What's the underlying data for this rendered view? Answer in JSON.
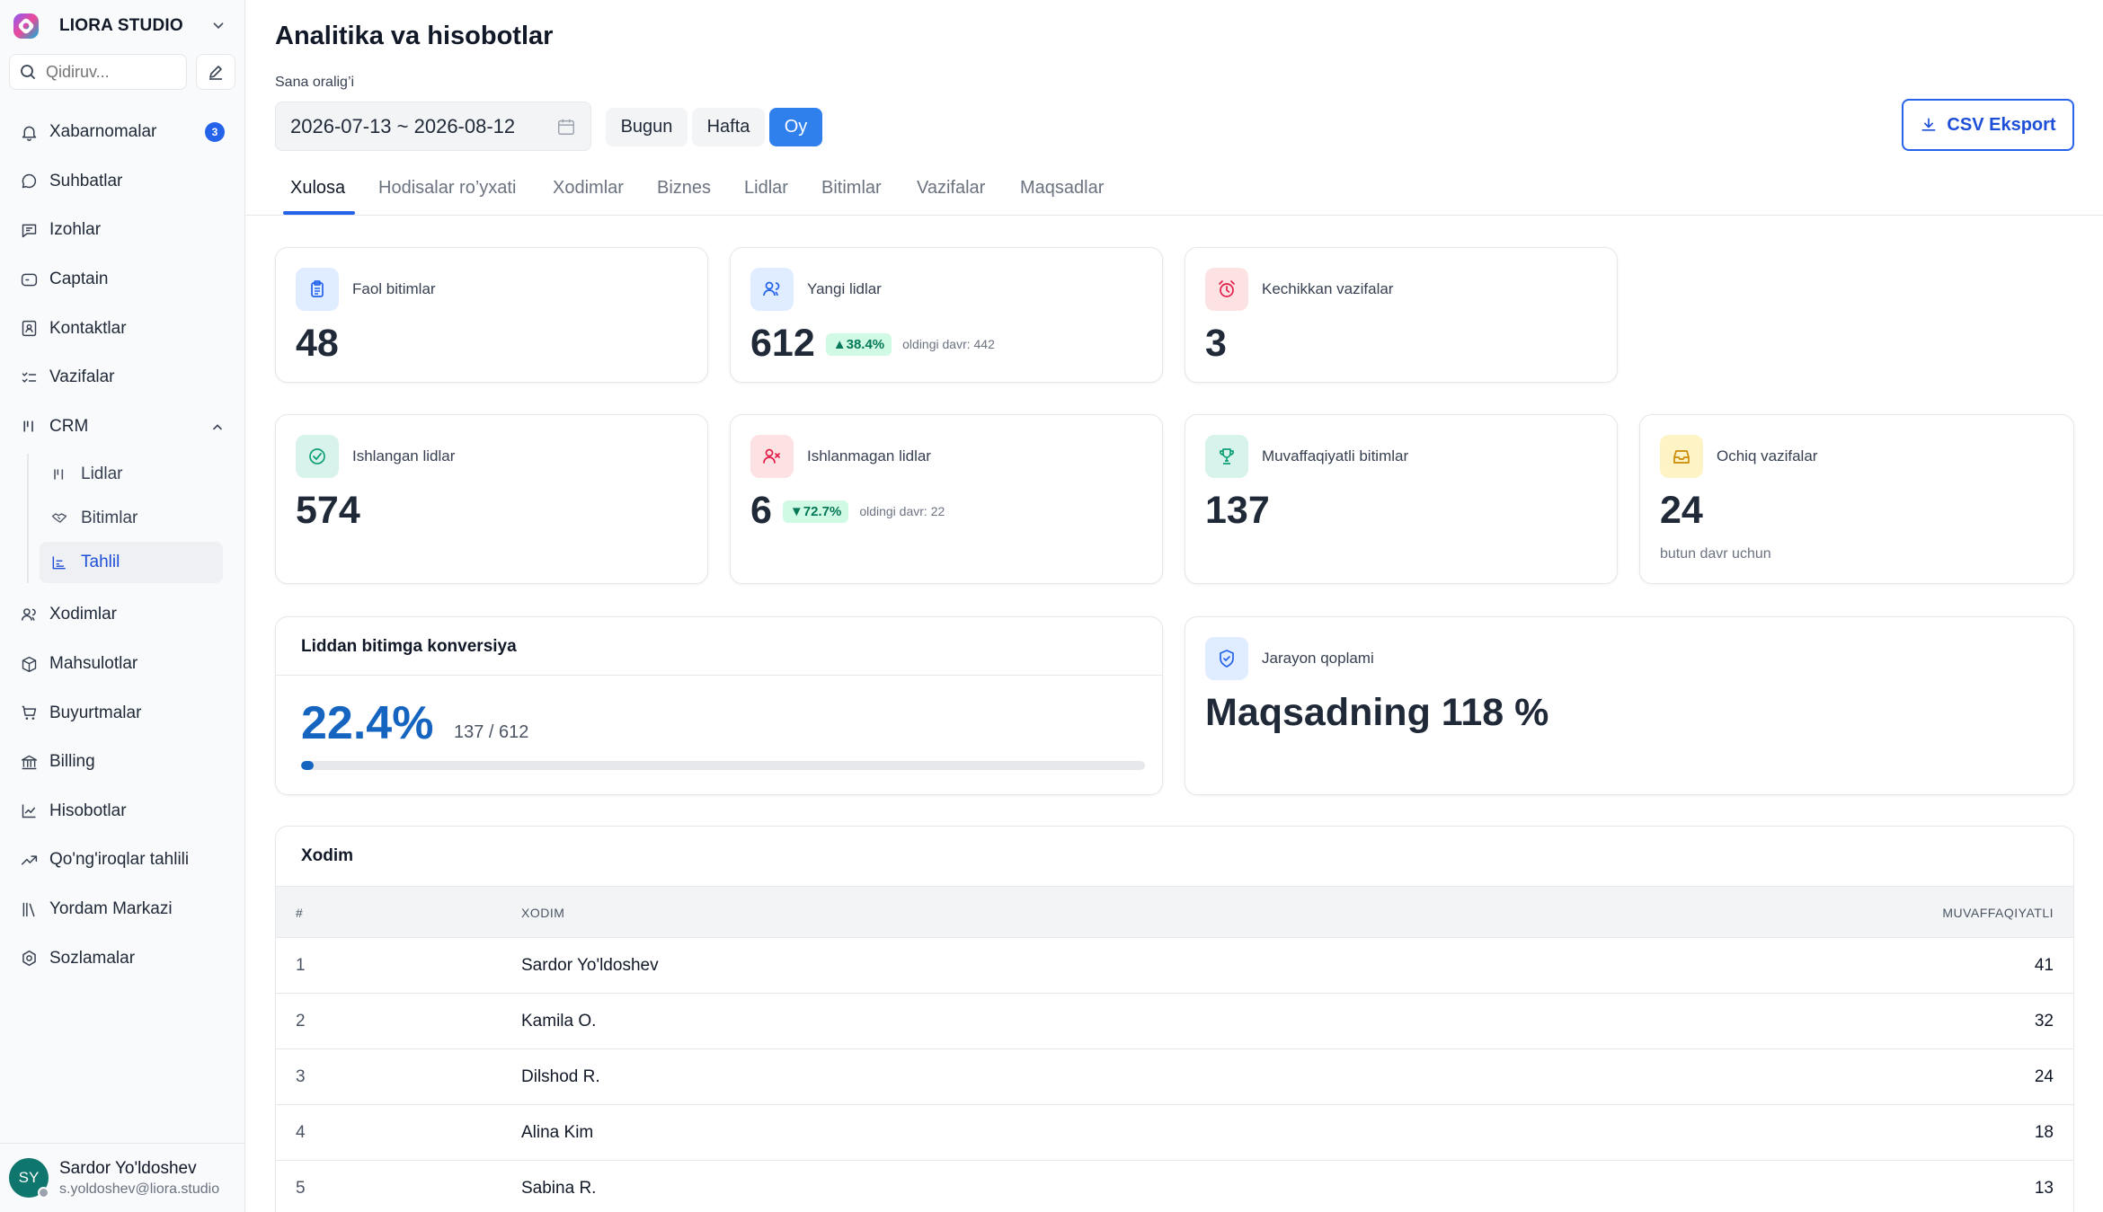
{
  "brand": {
    "name": "LIORA STUDIO"
  },
  "search": {
    "placeholder": "Qidiruv..."
  },
  "nav": {
    "items": [
      {
        "label": "Xabarnomalar",
        "icon": "bell-icon",
        "badge": "3"
      },
      {
        "label": "Suhbatlar",
        "icon": "chat-icon"
      },
      {
        "label": "Izohlar",
        "icon": "note-icon"
      },
      {
        "label": "Captain",
        "icon": "captain-icon"
      },
      {
        "label": "Kontaktlar",
        "icon": "contacts-icon"
      },
      {
        "label": "Vazifalar",
        "icon": "tasks-icon"
      },
      {
        "label": "CRM",
        "icon": "crm-icon"
      }
    ],
    "crm_sub": [
      {
        "label": "Lidlar",
        "icon": "leads-icon"
      },
      {
        "label": "Bitimlar",
        "icon": "handshake-icon"
      },
      {
        "label": "Tahlil",
        "icon": "chart-icon"
      }
    ],
    "items_after": [
      {
        "label": "Xodimlar",
        "icon": "users-icon"
      },
      {
        "label": "Mahsulotlar",
        "icon": "box-icon"
      },
      {
        "label": "Buyurtmalar",
        "icon": "cart-icon"
      },
      {
        "label": "Billing",
        "icon": "bank-icon"
      },
      {
        "label": "Hisobotlar",
        "icon": "line-chart-icon"
      },
      {
        "label": "Qo'ng'iroqlar tahlili",
        "icon": "trend-icon"
      },
      {
        "label": "Yordam Markazi",
        "icon": "library-icon"
      },
      {
        "label": "Sozlamalar",
        "icon": "settings-icon"
      }
    ]
  },
  "user": {
    "initials": "SY",
    "name": "Sardor Yo'ldoshev",
    "email": "s.yoldoshev@liora.studio"
  },
  "header": {
    "title": "Analitika va hisobotlar",
    "range_label": "Sana oralig’i",
    "date_range": "2026-07-13 ~ 2026-08-12",
    "periods": [
      "Bugun",
      "Hafta",
      "Oy"
    ],
    "active_period": "Oy",
    "export_label": "CSV Eksport"
  },
  "tabs": [
    "Xulosa",
    "Hodisalar ro’yxati",
    "Xodimlar",
    "Biznes",
    "Lidlar",
    "Bitimlar",
    "Vazifalar",
    "Maqsadlar"
  ],
  "kpis": {
    "active_deals": {
      "label": "Faol bitimlar",
      "value": "48"
    },
    "new_leads": {
      "label": "Yangi lidlar",
      "value": "612",
      "delta": "▲38.4%",
      "prev": "oldingi davr: 442"
    },
    "overdue_tasks": {
      "label": "Kechikkan vazifalar",
      "value": "3"
    },
    "processed_leads": {
      "label": "Ishlangan lidlar",
      "value": "574"
    },
    "unprocessed_leads": {
      "label": "Ishlanmagan lidlar",
      "value": "6",
      "delta": "▼72.7%",
      "prev": "oldingi davr: 22"
    },
    "won_deals": {
      "label": "Muvaffaqiyatli bitimlar",
      "value": "137"
    },
    "open_tasks": {
      "label": "Ochiq vazifalar",
      "value": "24",
      "sub": "butun davr uchun"
    }
  },
  "conversion": {
    "title": "Liddan bitimga konversiya",
    "percent": "22.4%",
    "fraction": "137 / 612",
    "progress": 0.0149
  },
  "goal": {
    "label": "Jarayon qoplami",
    "value": "Maqsadning 118 %"
  },
  "table": {
    "title": "Xodim",
    "headers": [
      "#",
      "XODIM",
      "MUVAFFAQIYATLI"
    ],
    "rows": [
      {
        "n": "1",
        "name": "Sardor Yo'ldoshev",
        "value": "41"
      },
      {
        "n": "2",
        "name": "Kamila O.",
        "value": "32"
      },
      {
        "n": "3",
        "name": "Dilshod R.",
        "value": "24"
      },
      {
        "n": "4",
        "name": "Alina Kim",
        "value": "18"
      },
      {
        "n": "5",
        "name": "Sabina R.",
        "value": "13"
      }
    ]
  },
  "colors": {
    "accent": "#2563eb",
    "conversion": "#1565c0"
  }
}
